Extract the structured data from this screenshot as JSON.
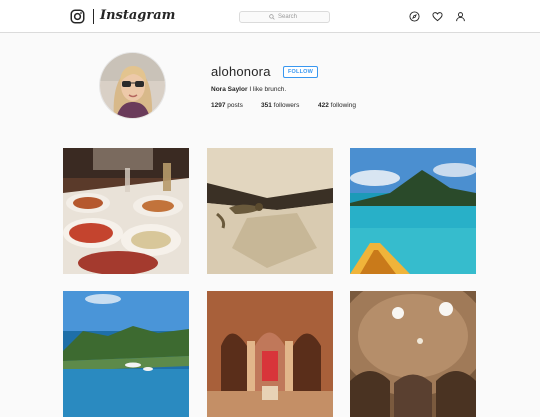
{
  "nav": {
    "brand": "Instagram",
    "search_placeholder": "Search",
    "icons": [
      "instagram-camera-icon",
      "compass-icon",
      "heart-icon",
      "person-icon",
      "search-icon"
    ]
  },
  "profile": {
    "username": "alohonora",
    "follow_label": "FOLLOW",
    "full_name": "Nora Saylor",
    "bio": "I like brunch.",
    "stats": {
      "posts_count": "1297",
      "posts_label": "posts",
      "followers_count": "351",
      "followers_label": "followers",
      "following_count": "422",
      "following_label": "following"
    }
  },
  "posts": [
    {
      "subject": "restaurant table with plates of food"
    },
    {
      "subject": "lizard on a rock"
    },
    {
      "subject": "kayak on a lagoon with a mountain island"
    },
    {
      "subject": "bay with boats and green hills"
    },
    {
      "subject": "ancient arched building interior"
    },
    {
      "subject": "domed ceiling with skylights"
    }
  ],
  "colors": {
    "accent": "#3897f0",
    "text": "#262626",
    "border": "#dbdbdb",
    "background": "#fafafa"
  }
}
